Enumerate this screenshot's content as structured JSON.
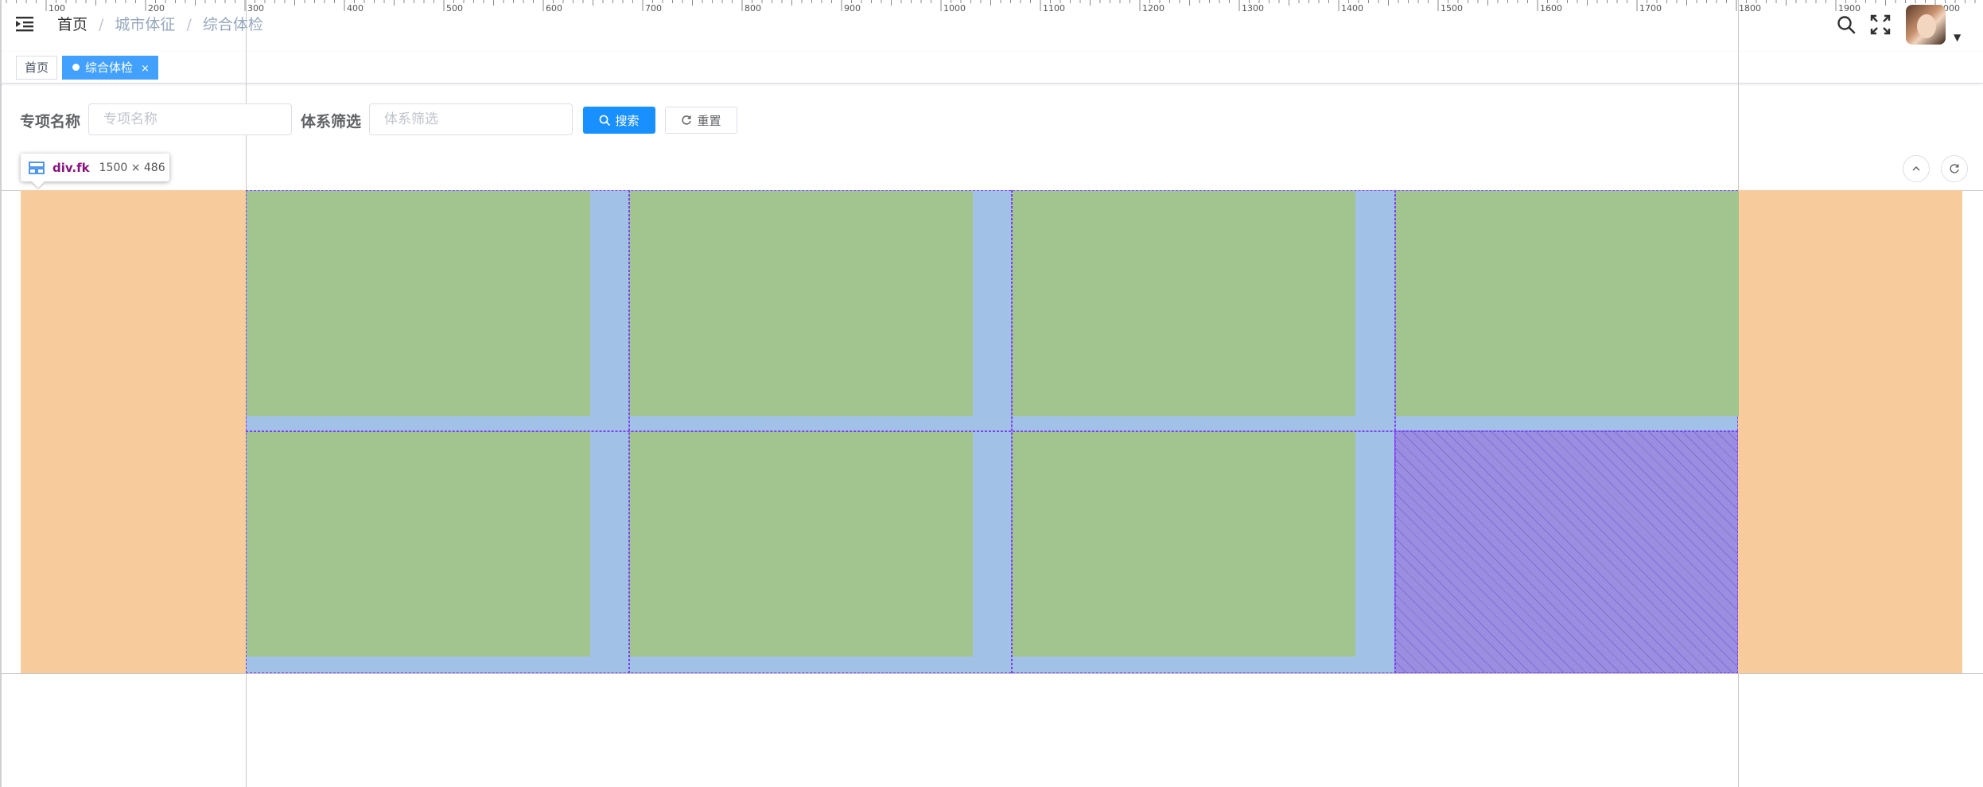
{
  "header": {
    "breadcrumb": [
      "首页",
      "城市体征",
      "综合体检"
    ],
    "separator": "/",
    "icons": [
      "hamburger-icon",
      "search-icon",
      "fullscreen-icon",
      "caret-down-icon"
    ]
  },
  "ruler": {
    "labels": [
      "100",
      "200",
      "300",
      "400",
      "500",
      "600",
      "700",
      "800",
      "900",
      "1000",
      "1100",
      "1200",
      "1300",
      "1400",
      "1500",
      "1600",
      "1700",
      "1800",
      "1900",
      "2000"
    ]
  },
  "tags": {
    "home_label": "首页",
    "active_label": "综合体检",
    "close_glyph": "×"
  },
  "form": {
    "name_label": "专项名称",
    "name_placeholder": "专项名称",
    "system_label": "体系筛选",
    "system_placeholder": "体系筛选",
    "search_button": "搜索",
    "reset_button": "重置"
  },
  "inspector": {
    "element": "div.fk",
    "size": "1500 × 486"
  },
  "colors": {
    "primary": "#1890ff",
    "tag_active": "#42a0ff",
    "margin_overlay": "#f7cb9c",
    "padding_overlay": "#a1c2e6",
    "content_overlay": "#a2c48e",
    "grid_outline": "#7f3ff3",
    "hatch_fill": "#9b8ee1"
  }
}
